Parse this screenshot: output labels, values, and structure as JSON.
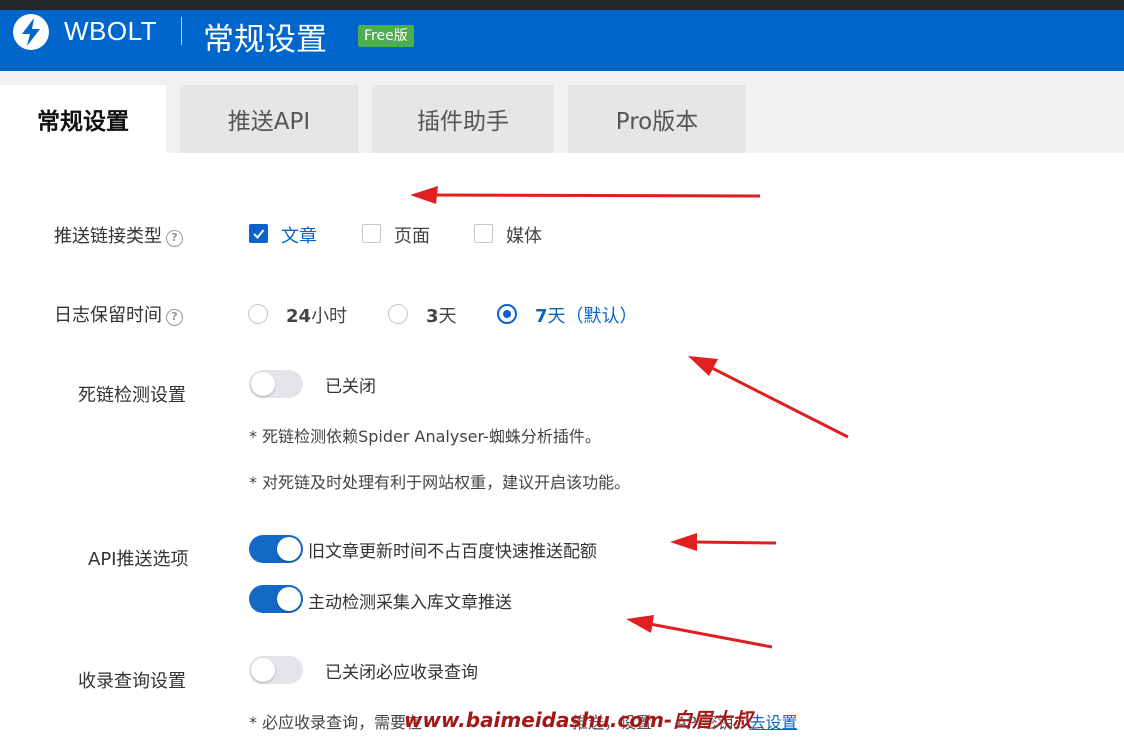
{
  "header": {
    "brand": "WBOLT",
    "title": "常规设置",
    "badge": "Free版",
    "bg_color": "#0066cc",
    "logo_icon": "lightning-bolt-icon"
  },
  "tabs": [
    {
      "label": "常规设置",
      "active": true
    },
    {
      "label": "推送API",
      "active": false
    },
    {
      "label": "插件助手",
      "active": false
    },
    {
      "label": "Pro版本",
      "active": false
    }
  ],
  "link_types": {
    "label": "推送链接类型",
    "help_icon": "question-circle-icon",
    "options": [
      {
        "label": "文章",
        "checked": true
      },
      {
        "label": "页面",
        "checked": false
      },
      {
        "label": "媒体",
        "checked": false
      }
    ]
  },
  "log_retention": {
    "label": "日志保留时间",
    "help_icon": "question-circle-icon",
    "options": [
      {
        "bold": "24",
        "rest": "小时",
        "checked": false
      },
      {
        "bold": "3",
        "rest": "天",
        "checked": false
      },
      {
        "bold": "7",
        "rest": "天（默认）",
        "checked": true
      }
    ]
  },
  "dead_link": {
    "label": "死链检测设置",
    "toggle_on": false,
    "status": "已关闭",
    "notes": [
      "* 死链检测依赖Spider Analyser-蜘蛛分析插件。",
      "* 对死链及时处理有利于网站权重，建议开启该功能。"
    ]
  },
  "api_push": {
    "label": "API推送选项",
    "options": [
      {
        "label": "旧文章更新时间不占百度快速推送配额",
        "on": true
      },
      {
        "label": "主动检测采集入库文章推送",
        "on": true
      }
    ]
  },
  "index_query": {
    "label": "收录查询设置",
    "toggle_on": false,
    "status": "已关闭必应收录查询",
    "note_prefix": "* 必应收录查询，需要在",
    "note_mid": "推送，设置",
    "note_suffix": "API密钥。",
    "note_link": "去设置"
  },
  "watermark": "www.baimeidashu.com-白眉大叔",
  "colors": {
    "accent": "#0a63c8",
    "free_badge": "#4cae4c",
    "arrow": "#e02020"
  }
}
